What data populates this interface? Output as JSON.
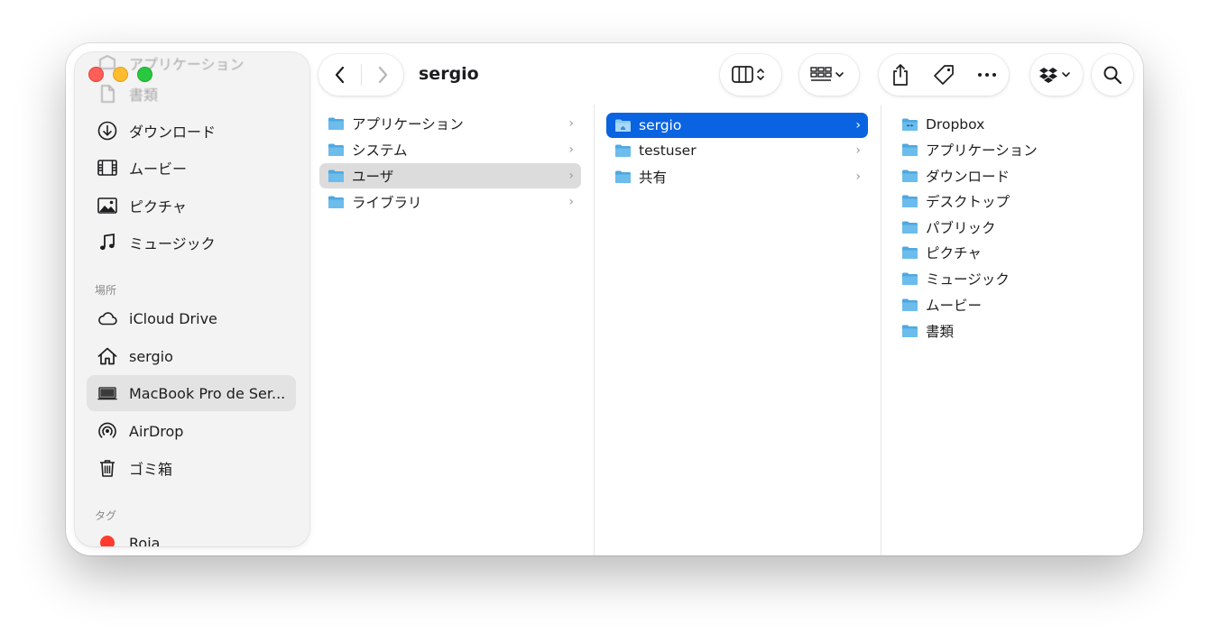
{
  "window": {
    "title": "sergio"
  },
  "sidebar": {
    "top_items": [
      {
        "label": "アプリケーション",
        "icon": "applications-icon"
      },
      {
        "label": "書類",
        "icon": "document-icon"
      },
      {
        "label": "ダウンロード",
        "icon": "download-icon"
      },
      {
        "label": "ムービー",
        "icon": "film-icon"
      },
      {
        "label": "ピクチャ",
        "icon": "photo-icon"
      },
      {
        "label": "ミュージック",
        "icon": "music-note-icon"
      }
    ],
    "locations_heading": "場所",
    "locations": [
      {
        "label": "iCloud Drive",
        "icon": "cloud-icon"
      },
      {
        "label": "sergio",
        "icon": "home-icon"
      },
      {
        "label": "MacBook Pro de Ser...",
        "icon": "laptop-icon",
        "active": true
      },
      {
        "label": "AirDrop",
        "icon": "airdrop-icon"
      },
      {
        "label": "ゴミ箱",
        "icon": "trash-icon"
      }
    ],
    "tags_heading": "タグ",
    "tags": [
      {
        "label": "Roja",
        "color": "#ff3b30"
      }
    ]
  },
  "toolbar": {
    "back_icon": "chevron-left-icon",
    "forward_icon": "chevron-right-icon",
    "view_icon": "column-view-icon",
    "group_icon": "group-grid-icon",
    "share_icon": "share-icon",
    "tag_icon": "tag-icon",
    "more_icon": "ellipsis-icon",
    "dropbox_icon": "dropbox-icon",
    "search_icon": "search-icon"
  },
  "columns": [
    {
      "items": [
        {
          "name": "アプリケーション",
          "has_children": true
        },
        {
          "name": "システム",
          "has_children": true
        },
        {
          "name": "ユーザ",
          "has_children": true,
          "state": "selected-inactive"
        },
        {
          "name": "ライブラリ",
          "has_children": true
        }
      ]
    },
    {
      "items": [
        {
          "name": "sergio",
          "has_children": true,
          "state": "selected-active"
        },
        {
          "name": "testuser",
          "has_children": true
        },
        {
          "name": "共有",
          "has_children": true
        }
      ]
    },
    {
      "items": [
        {
          "name": "Dropbox",
          "has_children": false,
          "badge": "dropbox"
        },
        {
          "name": "アプリケーション",
          "has_children": false
        },
        {
          "name": "ダウンロード",
          "has_children": false
        },
        {
          "name": "デスクトップ",
          "has_children": false
        },
        {
          "name": "パブリック",
          "has_children": false
        },
        {
          "name": "ピクチャ",
          "has_children": false
        },
        {
          "name": "ミュージック",
          "has_children": false
        },
        {
          "name": "ムービー",
          "has_children": false
        },
        {
          "name": "書類",
          "has_children": false
        }
      ]
    }
  ],
  "colors": {
    "selection_blue": "#0a63e0",
    "selection_grey": "#dcdcdc",
    "folder_blue": "#5ab2e6",
    "close": "#ff5f57",
    "minimize": "#febc2e",
    "zoom": "#28c840"
  }
}
